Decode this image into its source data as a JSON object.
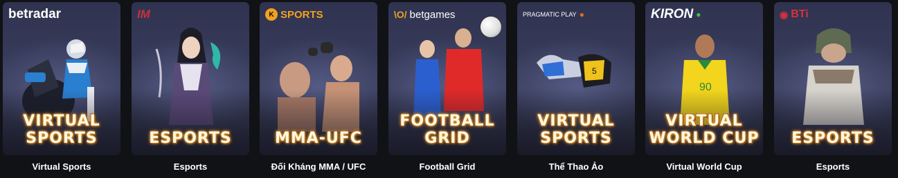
{
  "cards": [
    {
      "provider": "betradar",
      "title_line1": "VIRTUAL",
      "title_line2": "SPORTS",
      "caption": "Virtual Sports",
      "accent": "#2a7fd0"
    },
    {
      "provider": "IM",
      "title_line1": "",
      "title_line2": "ESPORTS",
      "caption": "Esports",
      "accent": "#c8323c"
    },
    {
      "provider": "SPORTS",
      "title_line1": "",
      "title_line2": "MMA-UFC",
      "caption": "Đối Kháng MMA / UFC",
      "accent": "#f2a11f"
    },
    {
      "provider": "betgames",
      "title_line1": "FOOTBALL",
      "title_line2": "GRID",
      "caption": "Football Grid",
      "accent": "#e8a325"
    },
    {
      "provider": "PRAGMATIC PLAY",
      "title_line1": "VIRTUAL",
      "title_line2": "SPORTS",
      "caption": "Thể Thao Ảo",
      "accent": "#e26b1f"
    },
    {
      "provider": "KIRON",
      "title_line1": "VIRTUAL",
      "title_line2": "WORLD CUP",
      "caption": "Virtual World Cup",
      "accent": "#3fbf3f"
    },
    {
      "provider": "BTi",
      "title_line1": "",
      "title_line2": "ESPORTS",
      "caption": "Esports",
      "accent": "#d8313d"
    }
  ]
}
